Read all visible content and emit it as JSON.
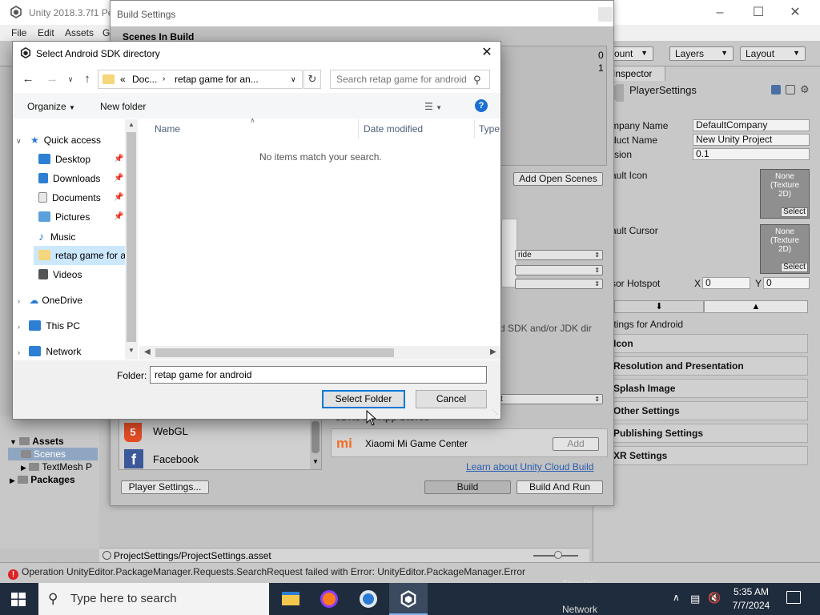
{
  "unity": {
    "title": "Unity 2018.3.7f1 Pe",
    "menu": [
      "File",
      "Edit",
      "Assets",
      "G"
    ],
    "toolbar": {
      "account": "ount",
      "layers": "Layers",
      "layout": "Layout"
    },
    "project": {
      "assets": "Assets",
      "scenes": "Scenes",
      "textmesh": "TextMesh P",
      "packages": "Packages"
    },
    "asset_path": "ProjectSettings/ProjectSettings.asset",
    "error_message": "Operation UnityEditor.PackageManager.Requests.SearchRequest failed with Error: UnityEditor.PackageManager.Error"
  },
  "inspector": {
    "tab": "Inspector",
    "object_name": "PlayerSettings",
    "company_label": "mpany Name",
    "company_value": "DefaultCompany",
    "product_label": "duct Name",
    "product_value": "New Unity Project",
    "version_label": "sion",
    "version_value": "0.1",
    "icon_label": "ault Icon",
    "cursor_label": "ault Cursor",
    "texture_none": "None\n(Texture\n2D)",
    "select_label": "Select",
    "hotspot_label": "sor Hotspot",
    "hotspot_x_label": "X",
    "hotspot_x": "0",
    "hotspot_y_label": "Y",
    "hotspot_y": "0",
    "android_header": "ttings for Android",
    "sections": [
      "Icon",
      "Resolution and Presentation",
      "Splash Image",
      "Other Settings",
      "Publishing Settings",
      "XR Settings"
    ]
  },
  "build": {
    "title": "Build Settings",
    "scenes_header": "Scenes In Build",
    "scene_index_0": "0",
    "scene_index_1": "1",
    "add_open_scenes": "Add Open Scenes",
    "override_drop": "ride",
    "sdk_message": "d SDK and/or JDK dir",
    "drop_t": "t",
    "platforms": [
      {
        "name": "WebGL",
        "icon": "html5-icon"
      },
      {
        "name": "Facebook",
        "icon": "facebook-icon"
      }
    ],
    "app_stores_header": "SDKs for App Stores",
    "xiaomi": "Xiaomi Mi Game Center",
    "add": "Add",
    "learn_link": "Learn about Unity Cloud Build",
    "player_settings": "Player Settings...",
    "build": "Build",
    "build_and_run": "Build And Run"
  },
  "dialog": {
    "title": "Select Android SDK directory",
    "breadcrumb_sep": "«",
    "breadcrumb": [
      "Doc...",
      "retap game for an..."
    ],
    "search_placeholder": "Search retap game for android",
    "organize": "Organize",
    "new_folder": "New folder",
    "columns": {
      "name": "Name",
      "date": "Date modified",
      "type": "Type"
    },
    "empty_message": "No items match your search.",
    "nav": {
      "quick_access": "Quick access",
      "items": [
        "Desktop",
        "Downloads",
        "Documents",
        "Pictures",
        "Music",
        "retap game for a",
        "Videos"
      ],
      "onedrive": "OneDrive",
      "thispc": "This PC",
      "network": "Network"
    },
    "folder_label": "Folder:",
    "folder_value": "retap game for android",
    "select_folder": "Select Folder",
    "cancel": "Cancel"
  },
  "taskbar": {
    "search_placeholder": "Type here to search",
    "time": "5:35 AM",
    "date": "7/7/2024",
    "bg_thispc": "This PC",
    "bg_network": "Network"
  },
  "colors": {
    "error": "#dd2222",
    "link": "#2a5db0",
    "accent": "#0078d7"
  }
}
